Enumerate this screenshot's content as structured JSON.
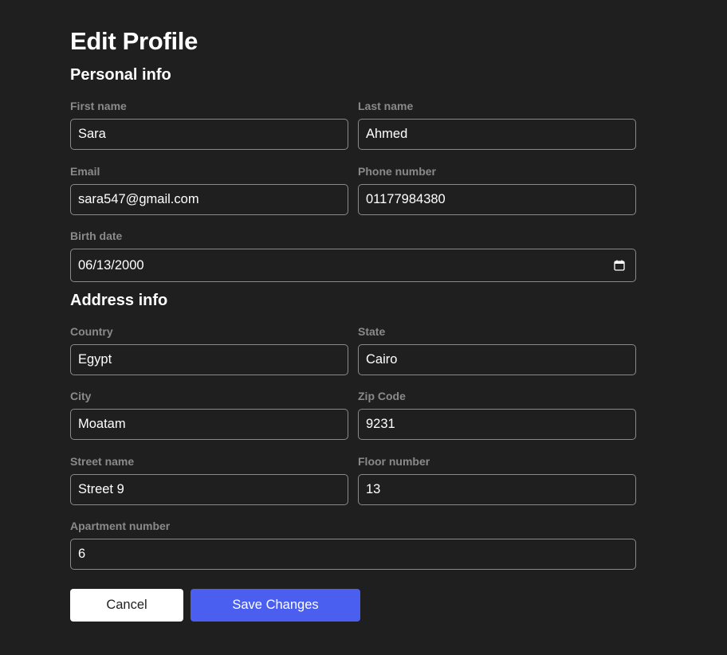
{
  "page": {
    "title": "Edit Profile"
  },
  "sections": {
    "personal": "Personal info",
    "address": "Address info"
  },
  "fields": {
    "first_name": {
      "label": "First name",
      "value": "Sara"
    },
    "last_name": {
      "label": "Last name",
      "value": "Ahmed"
    },
    "email": {
      "label": "Email",
      "value": "sara547@gmail.com"
    },
    "phone": {
      "label": "Phone number",
      "value": "01177984380"
    },
    "birth_date": {
      "label": "Birth date",
      "value": "06/13/2000",
      "icon": "calendar-icon"
    },
    "country": {
      "label": "Country",
      "value": "Egypt"
    },
    "state": {
      "label": "State",
      "value": "Cairo"
    },
    "city": {
      "label": "City",
      "value": "Moatam"
    },
    "zip": {
      "label": "Zip Code",
      "value": "9231"
    },
    "street": {
      "label": "Street name",
      "value": "Street 9"
    },
    "floor": {
      "label": "Floor number",
      "value": "13"
    },
    "apartment": {
      "label": "Apartment number",
      "value": "6"
    }
  },
  "actions": {
    "cancel_label": "Cancel",
    "save_label": "Save Changes"
  },
  "colors": {
    "background": "#1f1f1f",
    "label": "#8a8a8a",
    "input_border": "#8a8a8a",
    "primary": "#4a5ff0",
    "cancel_bg": "#ffffff"
  }
}
